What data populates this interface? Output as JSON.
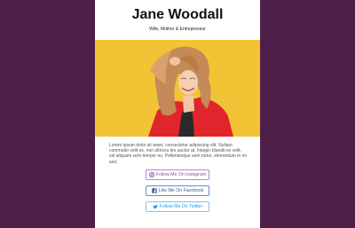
{
  "profile": {
    "name": "Jane Woodall",
    "tagline": "Wife, Mother & Entrepreneur",
    "bio": "Lorem ipsum dolor sit amet, consectetur adipiscing elit. Nullam commodo velit ex, non ultrices leo auctor at. Integer blandit ex velit, vel aliquam sem tempor eu. Pellentesque sem tortor, elementum in mi sed."
  },
  "buttons": {
    "instagram": {
      "label": "Follow Me On Instagram",
      "icon": "instagram-icon"
    },
    "facebook": {
      "label": "Like Me On Facebook",
      "icon": "facebook-icon"
    },
    "twitter": {
      "label": "Follow Me On Twitter",
      "icon": "twitter-icon"
    }
  },
  "colors": {
    "page_background": "#4e1f48",
    "hero_background": "#f2c334",
    "instagram": "#8a52a6",
    "facebook": "#3b5998",
    "twitter": "#1d9bf0"
  }
}
